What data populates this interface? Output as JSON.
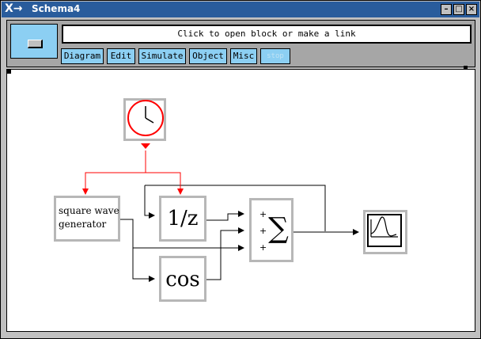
{
  "window": {
    "title": "Schema4",
    "menu_glyph": "X→",
    "minimize_glyph": "–",
    "maximize_glyph": "□",
    "close_glyph": "×"
  },
  "toolbar": {
    "message": "Click to open block or make a link",
    "menus": [
      "Diagram",
      "Edit",
      "Simulate",
      "Object",
      "Misc",
      "stop"
    ]
  },
  "diagram": {
    "blocks": {
      "clock": "clock",
      "square_wave_line1": "square wave",
      "square_wave_line2": "generator",
      "delay": "1/z",
      "cos": "cos",
      "sum_sign1": "+",
      "sum_sign2": "+",
      "sum_sign3": "+",
      "sum_symbol": "∑"
    },
    "colors": {
      "link": "#000000",
      "activation_link": "#ff0000",
      "block_shadow": "#b7b7b7",
      "block_face": "#ffffff",
      "accent": "#8ccff3",
      "titlebar": "#295c9c"
    }
  }
}
